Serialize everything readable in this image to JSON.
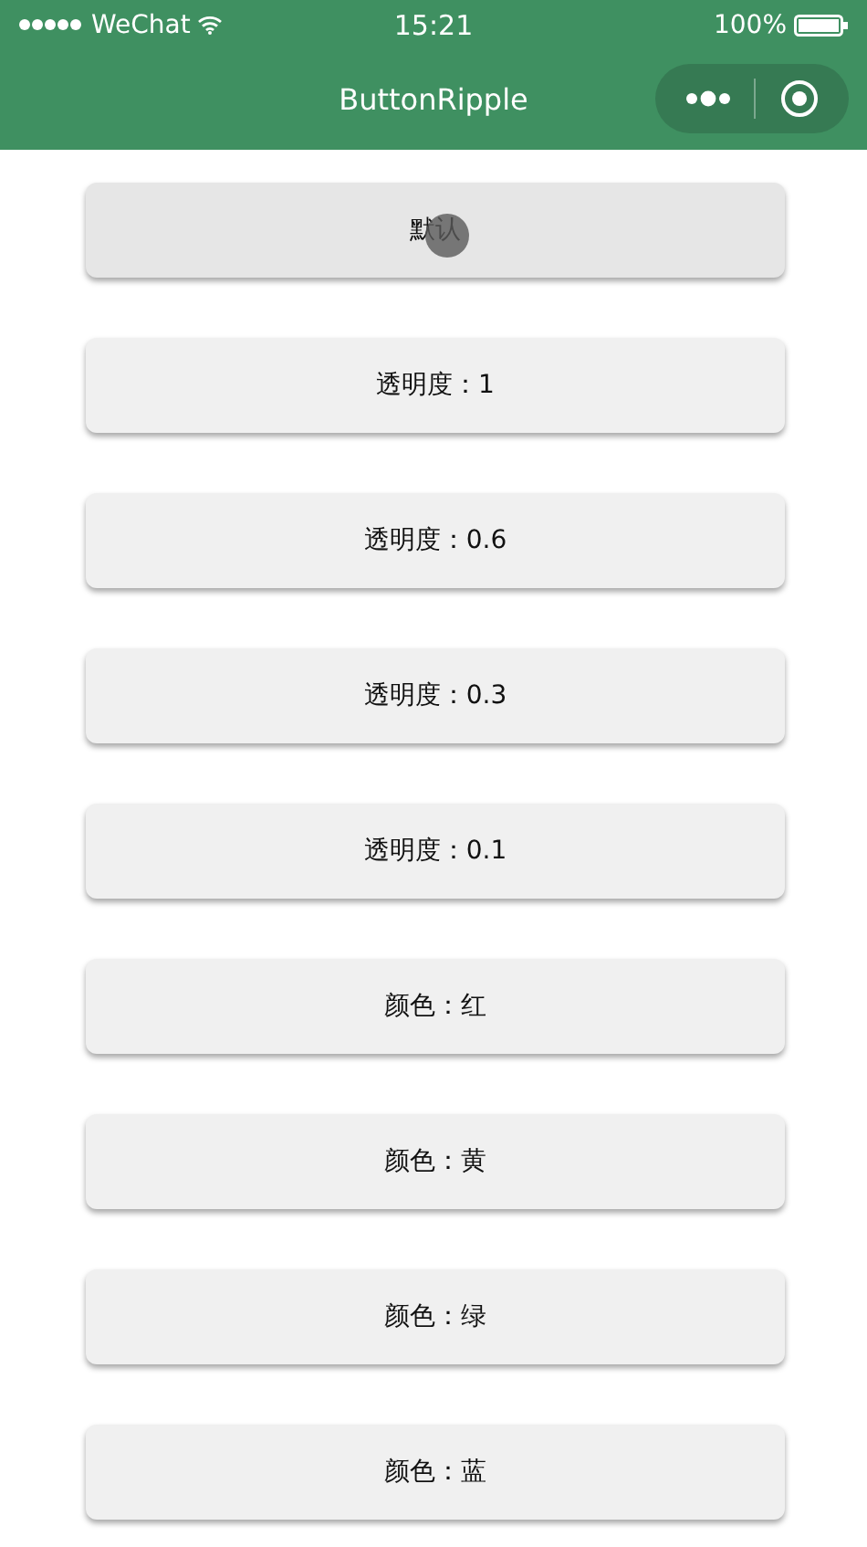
{
  "status_bar": {
    "carrier": "WeChat",
    "time": "15:21",
    "battery": "100%"
  },
  "nav_bar": {
    "title": "ButtonRipple"
  },
  "buttons": [
    {
      "label": "默认",
      "pressed": true
    },
    {
      "label": "透明度：1",
      "pressed": false
    },
    {
      "label": "透明度：0.6",
      "pressed": false
    },
    {
      "label": "透明度：0.3",
      "pressed": false
    },
    {
      "label": "透明度：0.1",
      "pressed": false
    },
    {
      "label": "颜色：红",
      "pressed": false
    },
    {
      "label": "颜色：黄",
      "pressed": false
    },
    {
      "label": "颜色：绿",
      "pressed": false
    },
    {
      "label": "颜色：蓝",
      "pressed": false
    }
  ]
}
